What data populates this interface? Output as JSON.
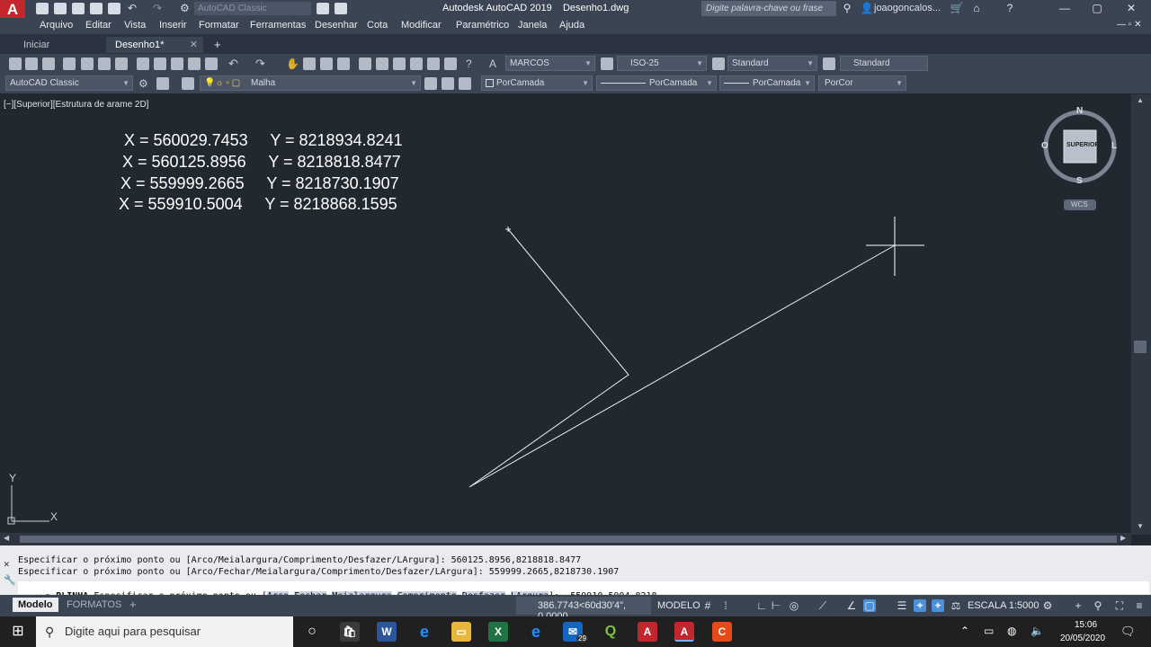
{
  "title": {
    "app_title": "Autodesk AutoCAD 2019",
    "file_name": "Desenho1.dwg",
    "workspace": "AutoCAD Classic",
    "search_placeholder": "Digite palavra-chave ou frase",
    "user": "joaogoncalos..."
  },
  "menu": [
    "Arquivo",
    "Editar",
    "Vista",
    "Inserir",
    "Formatar",
    "Ferramentas",
    "Desenhar",
    "Cota",
    "Modificar",
    "Paramétrico",
    "Janela",
    "Ajuda"
  ],
  "doc_tabs": [
    {
      "label": "Iniciar"
    },
    {
      "label": "Desenho1*"
    }
  ],
  "toolbar": {
    "text_style": "MARCOS",
    "dim_style": "ISO-25",
    "table_style": "Standard",
    "multileader_style": "Standard",
    "workspace_combo": "AutoCAD Classic",
    "layer": "Malha",
    "color": "PorCamada",
    "linetype": "PorCamada",
    "lineweight": "PorCamada",
    "plotstyle": "PorCor"
  },
  "viewport": {
    "label": "[−][Superior][Estrutura de arame 2D]",
    "coords": [
      {
        "x": "X = 560029.7453",
        "y": "Y = 8218934.8241"
      },
      {
        "x": "X = 560125.8956",
        "y": "Y = 8218818.8477"
      },
      {
        "x": "X = 559999.2665",
        "y": "Y = 8218730.1907"
      },
      {
        "x": "X = 559910.5004",
        "y": "Y = 8218868.1595"
      }
    ],
    "viewcube": {
      "north": "N",
      "south": "S",
      "east": "L",
      "west": "O",
      "face": "SUPERIOR",
      "wcs": "WCS"
    },
    "ucs": {
      "x": "X",
      "y": "Y"
    }
  },
  "command": {
    "history": [
      "Especificar o próximo ponto ou [Arco/Meialargura/Comprimento/Desfazer/LArgura]: 560125.8956,8218818.8477",
      "Especificar o próximo ponto ou [Arco/Fechar/Meialargura/Comprimento/Desfazer/LArgura]: 559999.2665,8218730.1907"
    ],
    "prompt_cmd": "PLINHA",
    "prompt_text": "Especificar o próximo ponto ou [",
    "options": [
      "Arco",
      "Fechar",
      "Meialargura",
      "Comprimento",
      "Desfazer",
      "LArgura"
    ],
    "prompt_end": "]:",
    "input": "559910.5004,8218"
  },
  "status": {
    "tabs": [
      "Modelo",
      "FORMATOS"
    ],
    "coords": "386.7743<60d30'4\", 0.0000",
    "mode": "MODELO",
    "scale": "ESCALA 1:5000"
  },
  "taskbar": {
    "search_placeholder": "Digite aqui para pesquisar",
    "time": "15:06",
    "date": "20/05/2020",
    "mail_badge": "29"
  },
  "colors": {
    "background": "#212830",
    "accent": "#c1272d"
  }
}
